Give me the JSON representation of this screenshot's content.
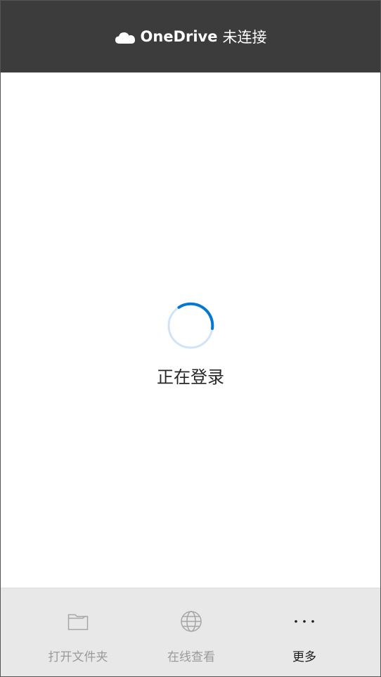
{
  "header": {
    "brand": "OneDrive",
    "status": "未连接"
  },
  "main": {
    "loading_text": "正在登录"
  },
  "footer": {
    "items": [
      {
        "label": "打开文件夹",
        "icon": "folder-icon"
      },
      {
        "label": "在线查看",
        "icon": "globe-icon"
      },
      {
        "label": "更多",
        "icon": "more-icon"
      }
    ]
  },
  "colors": {
    "header_bg": "#3c3c3c",
    "accent": "#0078d4",
    "spinner_track": "#cfe4f7",
    "footer_bg": "#e8e8e8",
    "disabled_text": "#9a9a9a"
  }
}
